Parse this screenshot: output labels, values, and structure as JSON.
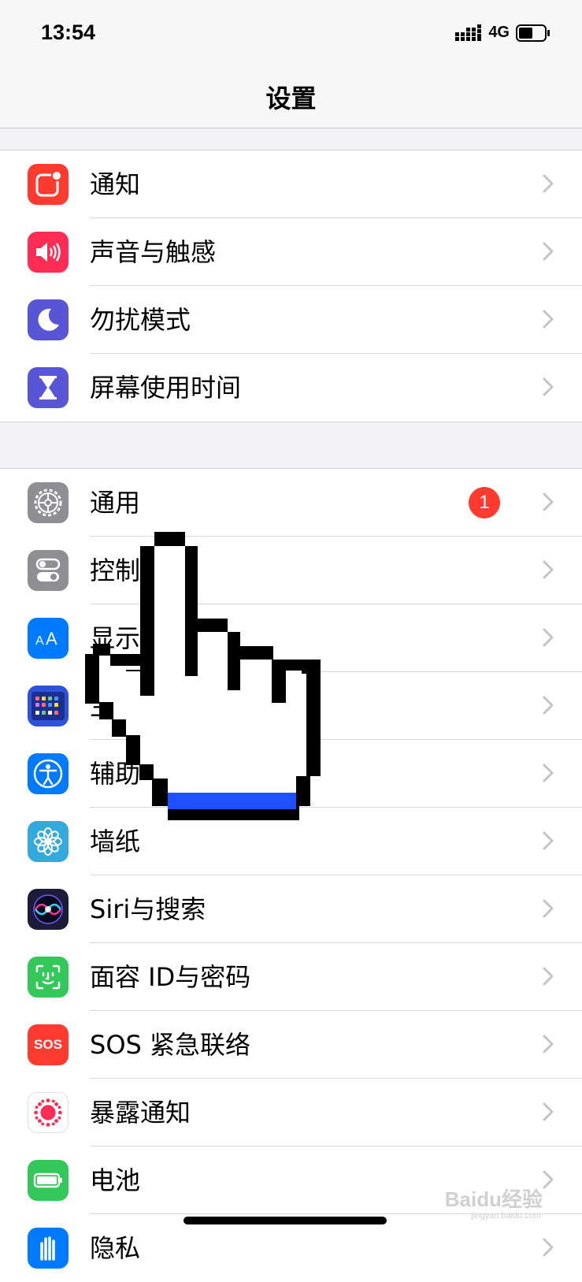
{
  "status_bar": {
    "time": "13:54",
    "network": "4G"
  },
  "nav": {
    "title": "设置"
  },
  "group1": [
    {
      "label": "通知",
      "icon": "notification-icon",
      "color": "#ff3b30"
    },
    {
      "label": "声音与触感",
      "icon": "speaker-icon",
      "color": "#ff2d55"
    },
    {
      "label": "勿扰模式",
      "icon": "moon-icon",
      "color": "#5856d6"
    },
    {
      "label": "屏幕使用时间",
      "icon": "hourglass-icon",
      "color": "#5856d6"
    }
  ],
  "group2": [
    {
      "label": "通用",
      "icon": "gear-icon",
      "color": "#8e8e93",
      "badge": "1"
    },
    {
      "label": "控制",
      "icon": "toggle-icon",
      "color": "#8e8e93"
    },
    {
      "label": "显示",
      "icon": "text-size-icon",
      "color": "#007aff"
    },
    {
      "label": "主",
      "icon": "home-grid-icon",
      "color": "#2c53d9"
    },
    {
      "label": "辅助",
      "icon": "accessibility-icon",
      "color": "#007aff"
    },
    {
      "label": "墙纸",
      "icon": "flower-icon",
      "color": "#34aadc"
    },
    {
      "label": "Siri与搜索",
      "icon": "siri-icon",
      "color": "#1c1c3a"
    },
    {
      "label": "面容 ID与密码",
      "icon": "face-id-icon",
      "color": "#34c759"
    },
    {
      "label": "SOS 紧急联络",
      "icon": "sos-icon",
      "color": "#ff3b30",
      "icon_text": "SOS"
    },
    {
      "label": "暴露通知",
      "icon": "exposure-icon",
      "color": "#ffffff"
    },
    {
      "label": "电池",
      "icon": "battery-icon",
      "color": "#34c759"
    },
    {
      "label": "隐私",
      "icon": "hand-icon",
      "color": "#007aff"
    }
  ],
  "watermark": {
    "text": "Baidu经验",
    "sub": "jingyan.baidu.com"
  },
  "colors": {
    "background": "#f2f2f7",
    "chevron": "#c4c4c7",
    "badge": "#ff3b30",
    "cursor_blue": "#1e50ff"
  }
}
